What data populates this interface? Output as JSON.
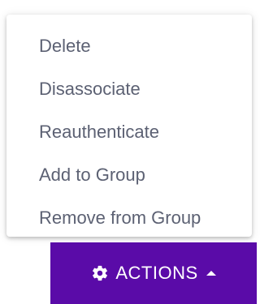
{
  "menu": {
    "items": [
      {
        "label": "Delete"
      },
      {
        "label": "Disassociate"
      },
      {
        "label": "Reauthenticate"
      },
      {
        "label": "Add to Group"
      },
      {
        "label": "Remove from Group"
      }
    ]
  },
  "actions_button": {
    "label": "ACTIONS",
    "icon": "gear-icon",
    "caret_icon": "caret-up-icon",
    "background_color": "#5a0ba8"
  },
  "colors": {
    "menu_text": "#5c6173",
    "button_text": "#ffffff"
  }
}
